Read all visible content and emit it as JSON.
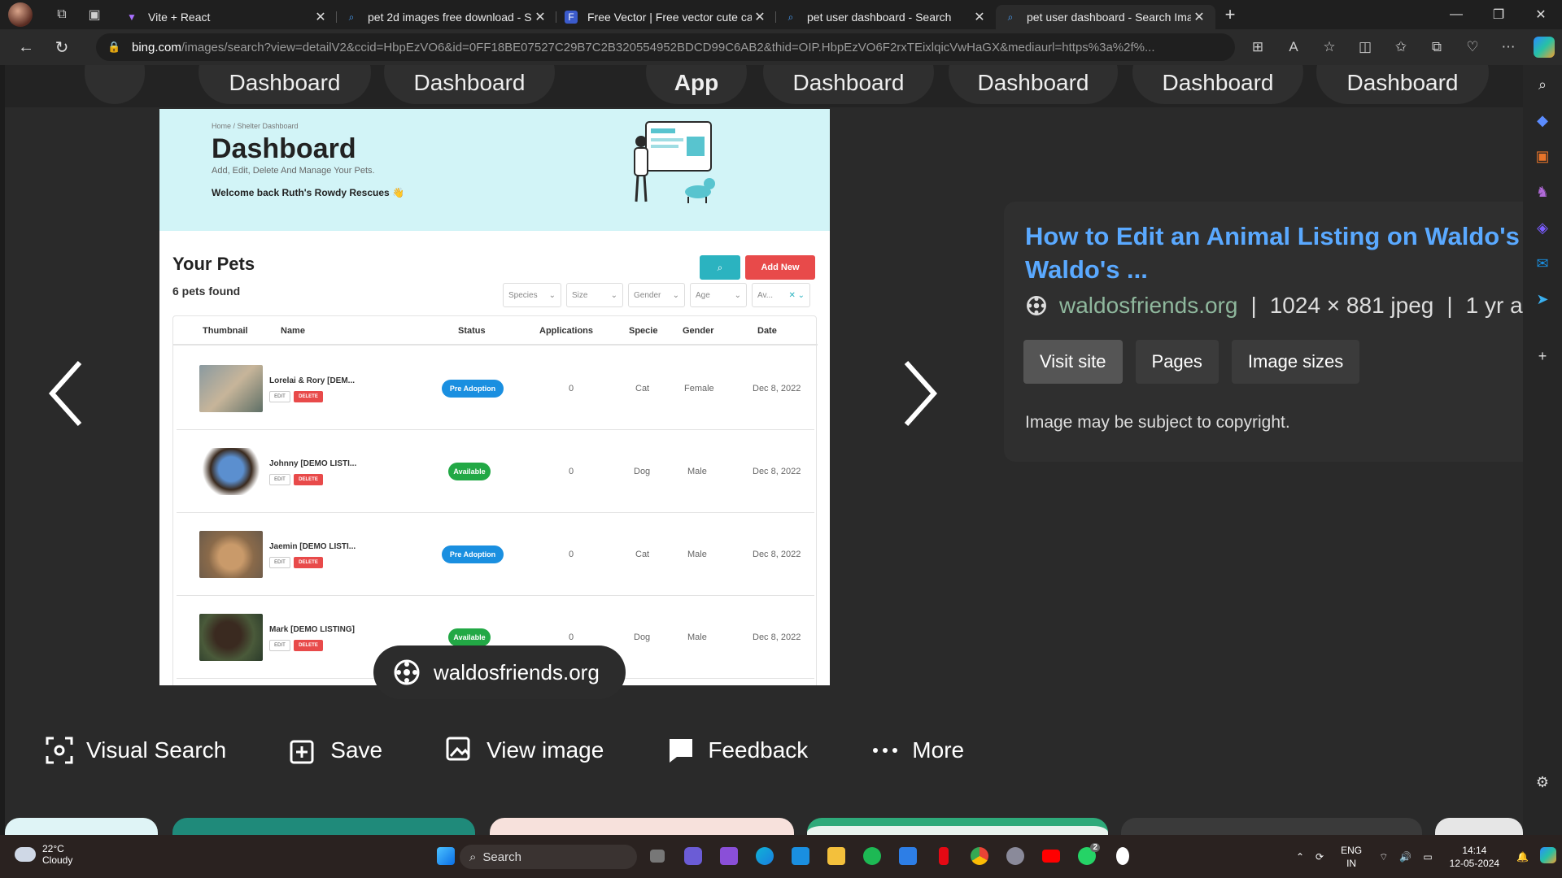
{
  "browser": {
    "tabs": [
      {
        "title": "Vite + React",
        "icon": "vite-icon"
      },
      {
        "title": "pet 2d images free download - S",
        "icon": "search-icon"
      },
      {
        "title": "Free Vector | Free vector cute car",
        "icon": "freepik-icon"
      },
      {
        "title": "pet user dashboard - Search",
        "icon": "search-icon"
      },
      {
        "title": "pet user dashboard - Search Ima",
        "icon": "search-icon"
      }
    ],
    "url_host": "bing.com",
    "url_rest": "/images/search?view=detailV2&ccid=HbpEzVO6&id=0FF18BE07527C29B7C2B320554952BDCD99C6AB2&thid=OIP.HbpEzVO6F2rxTEixlqicVwHaGX&mediaurl=https%3a%2f%..."
  },
  "strip": {
    "pills": [
      "Dashboard",
      "Dashboard",
      "App",
      "Dashboard",
      "Dashboard",
      "Dashboard",
      "Dashboard"
    ]
  },
  "preview": {
    "crumb": "Home / Shelter Dashboard",
    "title": "Dashboard",
    "subtitle": "Add, Edit, Delete And Manage Your Pets.",
    "welcome": "Welcome back Ruth's Rowdy Rescues 👋",
    "pets_title": "Your Pets",
    "pets_count": "6 pets found",
    "add_new": "Add New",
    "filters": [
      "Species",
      "Size",
      "Gender",
      "Age",
      "Av..."
    ],
    "columns": [
      "Thumbnail",
      "Name",
      "Status",
      "Applications",
      "Specie",
      "Gender",
      "Date"
    ],
    "edit_label": "EDIT",
    "delete_label": "DELETE",
    "rows": [
      {
        "name": "Lorelai & Rory [DEM...",
        "status": "Pre Adoption",
        "apps": "0",
        "specie": "Cat",
        "gender": "Female",
        "date": "Dec 8, 2022"
      },
      {
        "name": "Johnny [DEMO LISTI...",
        "status": "Available",
        "apps": "0",
        "specie": "Dog",
        "gender": "Male",
        "date": "Dec 8, 2022"
      },
      {
        "name": "Jaemin [DEMO LISTI...",
        "status": "Pre Adoption",
        "apps": "0",
        "specie": "Cat",
        "gender": "Male",
        "date": "Dec 8, 2022"
      },
      {
        "name": "Mark [DEMO LISTING]",
        "status": "Available",
        "apps": "0",
        "specie": "Dog",
        "gender": "Male",
        "date": "Dec 8, 2022"
      }
    ],
    "source_pill": "waldosfriends.org"
  },
  "info": {
    "title_line1": "How to Edit an Animal Listing on Waldo's F",
    "title_line2": "Waldo's ...",
    "domain": "waldosfriends.org",
    "meta": "1024 × 881 jpeg",
    "age": "1 yr a",
    "buttons": [
      "Visit site",
      "Pages",
      "Image sizes"
    ],
    "copyright": "Image may be subject to copyright."
  },
  "actions": [
    {
      "label": "Visual Search",
      "icon": "visual-search-icon"
    },
    {
      "label": "Save",
      "icon": "save-icon"
    },
    {
      "label": "View image",
      "icon": "view-image-icon"
    },
    {
      "label": "Feedback",
      "icon": "feedback-icon"
    },
    {
      "label": "More",
      "icon": "more-icon"
    }
  ],
  "taskbar": {
    "temp": "22°C",
    "weather": "Cloudy",
    "search": "Search",
    "lang1": "ENG",
    "lang2": "IN",
    "time": "14:14",
    "date": "12-05-2024",
    "whatsapp_badge": "2"
  },
  "colors": {
    "accent_blue": "#5aa9ff",
    "teal": "#2bb3c0",
    "red": "#e84a4a",
    "green": "#22a845",
    "badge_blue": "#1a8fe0"
  }
}
